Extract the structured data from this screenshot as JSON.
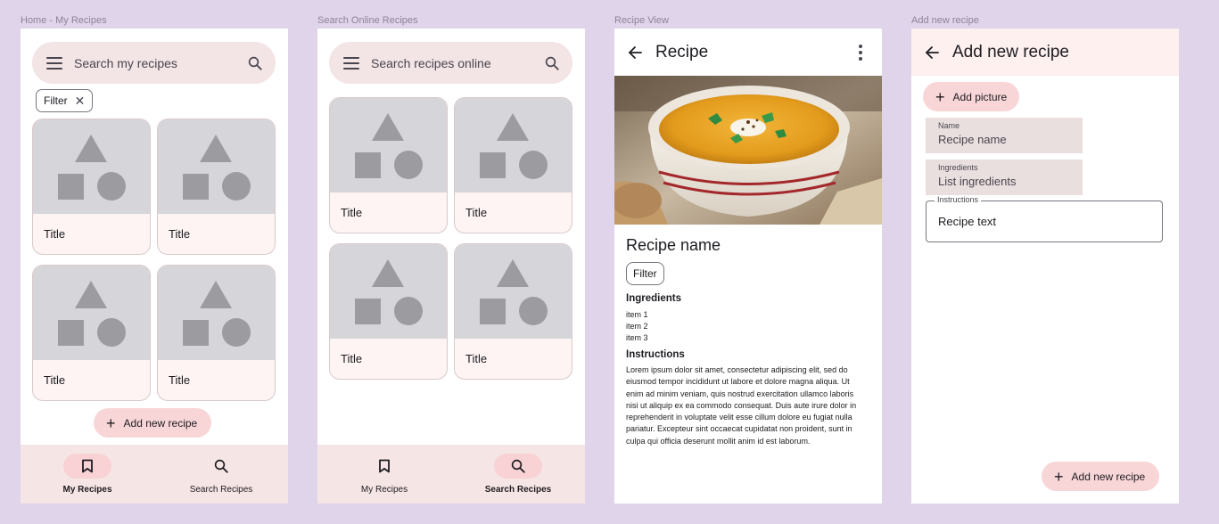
{
  "frames": {
    "home": {
      "label": "Home - My Recipes",
      "search_placeholder": "Search my recipes",
      "filter_chip": "Filter",
      "cards": [
        {
          "title": "Title"
        },
        {
          "title": "Title"
        },
        {
          "title": "Title"
        },
        {
          "title": "Title"
        }
      ],
      "fab_label": "Add new recipe",
      "nav": [
        {
          "label": "My Recipes",
          "icon": "bookmark-icon",
          "active": true
        },
        {
          "label": "Search Recipes",
          "icon": "search-icon",
          "active": false
        }
      ]
    },
    "search": {
      "label": "Search Online Recipes",
      "search_placeholder": "Search recipes online",
      "cards": [
        {
          "title": "Title"
        },
        {
          "title": "Title"
        },
        {
          "title": "Title"
        },
        {
          "title": "Title"
        }
      ],
      "nav": [
        {
          "label": "My Recipes",
          "icon": "bookmark-icon",
          "active": false
        },
        {
          "label": "Search Recipes",
          "icon": "search-icon",
          "active": true
        }
      ]
    },
    "view": {
      "label": "Recipe View",
      "app_bar_title": "Recipe",
      "recipe_name": "Recipe name",
      "filter_chip": "Filter",
      "ingredients_heading": "Ingredients",
      "ingredients": [
        "item 1",
        "item 2",
        "item 3"
      ],
      "instructions_heading": "Instructions",
      "instructions_text": "Lorem ipsum dolor sit amet, consectetur adipiscing elit, sed do eiusmod tempor incididunt ut labore et dolore magna aliqua. Ut enim ad minim veniam, quis nostrud exercitation ullamco laboris nisi ut aliquip ex ea commodo consequat. Duis aute irure dolor in reprehenderit in voluptate velit esse cillum dolore eu fugiat nulla pariatur. Excepteur sint occaecat cupidatat non proident, sunt in culpa qui officia deserunt mollit anim id est laborum."
    },
    "add": {
      "label": "Add new recipe",
      "app_bar_title": "Add new recipe",
      "add_picture_label": "Add picture",
      "name_label": "Name",
      "name_value": "Recipe name",
      "ingredients_label": "Ingredients",
      "ingredients_value": "List ingredients",
      "instructions_label": "Instructions",
      "instructions_value": "Recipe text",
      "fab_label": "Add new recipe"
    }
  },
  "colors": {
    "background": "#e0d4ea",
    "surface": "#ffffff",
    "search_bar": "#f3e4e5",
    "primary_container": "#f8d6d8",
    "nav_bar": "#f6e5e5",
    "card_placeholder": "#d6d6da"
  }
}
